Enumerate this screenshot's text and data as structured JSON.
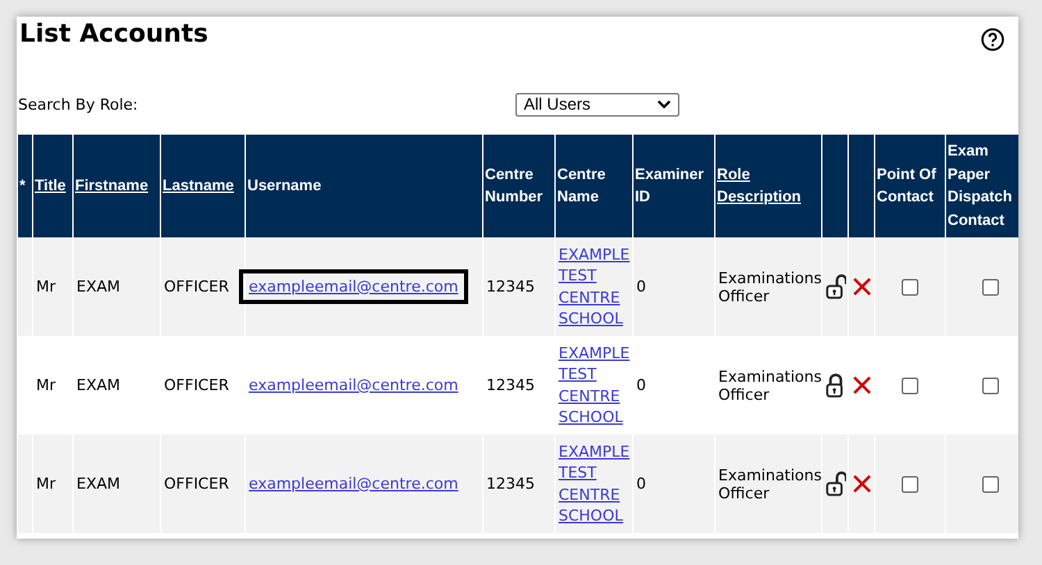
{
  "title": "List Accounts",
  "filter": {
    "label": "Search By Role:",
    "value": "All Users"
  },
  "table": {
    "columns": [
      {
        "label": "*",
        "sortable": false
      },
      {
        "label": "Title",
        "sortable": true
      },
      {
        "label": "Firstname",
        "sortable": true
      },
      {
        "label": "Lastname",
        "sortable": true
      },
      {
        "label": "Username",
        "sortable": false
      },
      {
        "label": "Centre Number",
        "sortable": false
      },
      {
        "label": "Centre Name",
        "sortable": false
      },
      {
        "label": "Examiner ID",
        "sortable": false
      },
      {
        "label": "Role Description",
        "sortable": true
      },
      {},
      {},
      {
        "label": "Point Of Contact",
        "sortable": false
      },
      {
        "label": "Exam Paper Dispatch Contact",
        "sortable": false
      }
    ],
    "rows": [
      {
        "title": "Mr",
        "firstname": "EXAM",
        "lastname": "OFFICER",
        "username": "exampleemail@centre.com",
        "highlighted": true,
        "centre_number": "12345",
        "centre_name": "EXAMPLE TEST CENTRE SCHOOL",
        "examiner_id": "0",
        "role": "Examinations Officer",
        "locked": false,
        "point_of_contact": false,
        "dispatch_contact": false
      },
      {
        "title": "Mr",
        "firstname": "EXAM",
        "lastname": "OFFICER",
        "username": "exampleemail@centre.com",
        "highlighted": false,
        "centre_number": "12345",
        "centre_name": "EXAMPLE TEST CENTRE SCHOOL",
        "examiner_id": "0",
        "role": "Examinations Officer",
        "locked": true,
        "point_of_contact": false,
        "dispatch_contact": false
      },
      {
        "title": "Mr",
        "firstname": "EXAM",
        "lastname": "OFFICER",
        "username": "exampleemail@centre.com",
        "highlighted": false,
        "centre_number": "12345",
        "centre_name": "EXAMPLE TEST CENTRE SCHOOL",
        "examiner_id": "0",
        "role": "Examinations Officer",
        "locked": false,
        "point_of_contact": false,
        "dispatch_contact": false
      }
    ]
  }
}
